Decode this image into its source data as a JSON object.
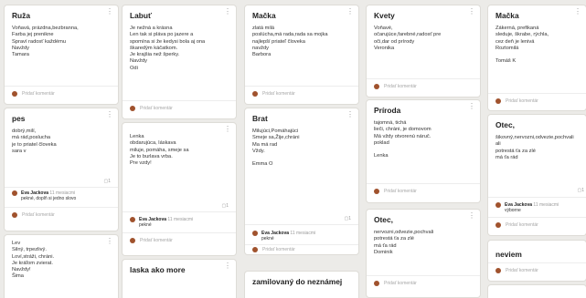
{
  "cards": {
    "ruza": {
      "title": "Ruža",
      "body": "Voňavá, prázdna,bezbranna,\nFarba jej prenikne\n Spraví radosť každému\nNavždy\nTamara",
      "add_comment": "Pridať komentár"
    },
    "pes": {
      "title": "pes",
      "body": "dobrý,milí,\nmá rád,poslucha\nje to priatel človeka\nsara v",
      "likes": "1",
      "comment": {
        "author": "Eva Jackova",
        "time": "11 mesiacmi",
        "text": "pekné, doplň si jedno slovo"
      },
      "add_comment": "Pridať komentár"
    },
    "lev": {
      "body": "  Lev\nSilný, trpezlivý.\nLoví,stráži, chráni.\nJe kráľom zvierat.\n  Navždy!\nŠima"
    },
    "labut": {
      "title": "Labuť",
      "body": "Je nežná a krásna\nLen tak si pláva po jazere  a\nspomína si že kedysi bola aj ona\nškaredým káčatkom.\nJe krajšia než šperky.\nNavždy\nOdi",
      "add_comment": "Pridať komentár"
    },
    "lenka": {
      "body": "Lenka\nobdarujúca, láskava\nmiluje, pomáha, smeje sa\nJe to burlava vrba.\nPre vzdy!",
      "likes": "1",
      "comment": {
        "author": "Eva Jackova",
        "time": "11 mesiacmi",
        "text": "pekné"
      },
      "add_comment": "Pridať komentár"
    },
    "laska": {
      "title": "laska ako more"
    },
    "macka1": {
      "title": "Mačka",
      "body": "zlatá milá\nposlúcha,má rada,rada sa mojka\nnajlepší priateľ človeka\nnavždy\nBarbora",
      "add_comment": "Pridať komentár"
    },
    "brat": {
      "title": "Brat",
      "body": "Milujúci,Pomáhajúci\nSmeje sa,Žije,chráni\nMa má rad\nVždy.\n\nEmma O",
      "likes": "1",
      "comment": {
        "author": "Eva Jackova",
        "time": "11 mesiacmi",
        "text": "pekné"
      },
      "add_comment": "Pridať komentár"
    },
    "zamilovany": {
      "title": "zamilovaný do neznámej"
    },
    "kvety": {
      "title": "Kvety",
      "body": "Voňavé,\nočarujúce,farebné,radosť pre\noči,dar od prírody\nVeronika",
      "add_comment": "Pridať komentár"
    },
    "priroda": {
      "title": "Príroda",
      "body": "tajomná, tichá\nlieči, chráni, je domovom\nMá vždy otvorenú náruč.\npoklad\n\nLenka",
      "add_comment": "Pridať komentár"
    },
    "otec1": {
      "title": "Otec,",
      "body": "nervozni,odvezie,pochvali\npotrestá ťa za zlé\nmá ťa rád\nDominik",
      "add_comment": "Pridať komentár"
    },
    "macka2": {
      "title": "Mačka",
      "body": "Zákerná, prefikaná\nsleduje, škrabe, rýchla,\ncez deň je lenivá\nRoztomilá\n\nTomáš K",
      "add_comment": "Pridať komentár"
    },
    "otec2": {
      "title": "Otec,",
      "body": "šikovný,nervozni,odvezie,pochvali\nali\npotrestá ťa za zlé\nmá ťa rád",
      "likes": "1",
      "comment": {
        "author": "Eva Jackova",
        "time": "11 mesiacmi",
        "text": "výborne"
      },
      "add_comment": "Pridať komentár"
    },
    "neviem": {
      "title": "neviem",
      "add_comment": "Pridať komentár"
    }
  },
  "icons": {
    "menu": "vertical-dots-icon",
    "like": "speech-bubble-icon",
    "avatar": "user-avatar-icon"
  },
  "colors": {
    "background": "#ecebe8",
    "avatar": "#a0522d"
  }
}
